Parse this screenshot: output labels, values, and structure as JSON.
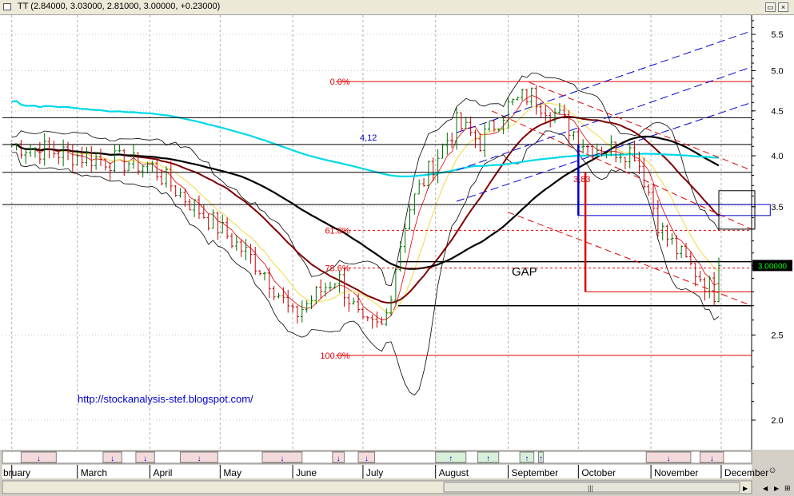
{
  "window": {
    "title": "TT (2.84000, 3.03000, 2.81000, 3.00000, +0.23000)",
    "restore_label": "▭",
    "close_label": "×"
  },
  "price_badge": "3.00000",
  "url_text": "http://stockanalysis-stef.blogspot.com/",
  "annotations": {
    "gap": "GAP",
    "level_412": "4,12",
    "level_383": "3,83"
  },
  "colors": {
    "fib": "#e00000",
    "ma_black": "#000000",
    "ma_cyan": "#00d8e8",
    "ma_maroon": "#800000",
    "ma_yellow": "#f0e060",
    "channel_blue": "#0000cc",
    "up_bar": "#007000",
    "down_bar": "#c00000",
    "badge_bg": "#000000",
    "badge_text": "#00ff00"
  },
  "footer": {
    "gear_symbol": "☺",
    "nav": [
      "◀",
      "▶",
      "⊞"
    ]
  },
  "chart_data": {
    "type": "ohlc",
    "symbol": "TT",
    "last_quote": {
      "open": 2.84,
      "high": 3.03,
      "low": 2.81,
      "close": 3.0,
      "change": 0.23
    },
    "y_axis": {
      "ticks": [
        5.5,
        5.0,
        4.5,
        4.0,
        3.5,
        2.5,
        2.0
      ],
      "scale": "log",
      "range": [
        1.83,
        5.85
      ]
    },
    "months": [
      "bruary",
      "March",
      "April",
      "May",
      "June",
      "July",
      "August",
      "September",
      "October",
      "November",
      "December"
    ],
    "fibonacci": [
      {
        "label": "0.0%",
        "price": 4.86
      },
      {
        "label": "61.8%",
        "price": 3.29
      },
      {
        "label": "78.6%",
        "price": 2.98
      },
      {
        "label": "100.0%",
        "price": 2.37
      }
    ],
    "price_levels": [
      4.42,
      4.12,
      3.83,
      3.52
    ],
    "gap": {
      "upper": 3.03,
      "lower": 2.7
    },
    "moving_averages": [
      "black",
      "cyan",
      "maroon",
      "yellow"
    ],
    "price_path": [
      {
        "d": "2011-02-01",
        "p": 4.12
      },
      {
        "d": "2011-03-01",
        "p": 4.0
      },
      {
        "d": "2011-04-01",
        "p": 3.9
      },
      {
        "d": "2011-04-15",
        "p": 3.6
      },
      {
        "d": "2011-05-01",
        "p": 3.3
      },
      {
        "d": "2011-05-20",
        "p": 2.95
      },
      {
        "d": "2011-06-01",
        "p": 2.62
      },
      {
        "d": "2011-06-20",
        "p": 2.92
      },
      {
        "d": "2011-07-01",
        "p": 2.55
      },
      {
        "d": "2011-07-10",
        "p": 2.55
      },
      {
        "d": "2011-07-20",
        "p": 3.45
      },
      {
        "d": "2011-08-10",
        "p": 4.35
      },
      {
        "d": "2011-08-20",
        "p": 4.15
      },
      {
        "d": "2011-09-01",
        "p": 4.55
      },
      {
        "d": "2011-09-10",
        "p": 4.7
      },
      {
        "d": "2011-09-20",
        "p": 4.5
      },
      {
        "d": "2011-10-05",
        "p": 4.1
      },
      {
        "d": "2011-10-25",
        "p": 4.05
      },
      {
        "d": "2011-11-05",
        "p": 3.3
      },
      {
        "d": "2011-11-15",
        "p": 3.05
      },
      {
        "d": "2011-11-28",
        "p": 2.8
      },
      {
        "d": "2011-11-30",
        "p": 3.0
      }
    ]
  }
}
